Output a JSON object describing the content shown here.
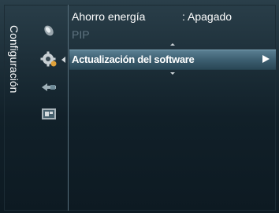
{
  "side_menu": {
    "title": "Configuración"
  },
  "icons": [
    {
      "name": "picture-icon"
    },
    {
      "name": "setup-icon",
      "selected": true
    },
    {
      "name": "input-icon"
    },
    {
      "name": "application-icon"
    }
  ],
  "menu": {
    "items": [
      {
        "label": "Ahorro energía",
        "value": ": Apagado"
      },
      {
        "label": "PIP"
      },
      {
        "label": "Actualización del software"
      }
    ]
  },
  "colors": {
    "highlight": "#4a6f82",
    "text": "#ffffff",
    "disabled_text": "#5f7380",
    "background": "#112029"
  }
}
